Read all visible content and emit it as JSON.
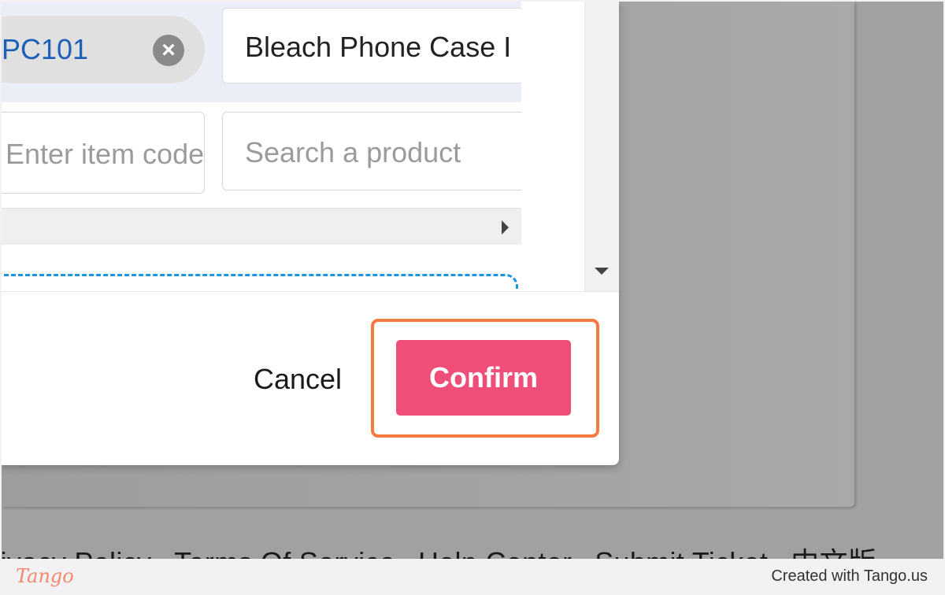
{
  "chip": {
    "label": "PC101",
    "close_icon": "close-circle-icon"
  },
  "row1": {
    "product_name": "Bleach Phone Case I"
  },
  "row2": {
    "code_placeholder": "Enter item code",
    "product_placeholder": "Search a product"
  },
  "scroll": {
    "right_arrow_icon": "triangle-right-icon",
    "down_arrow_icon": "triangle-down-icon"
  },
  "dialog": {
    "cancel_label": "Cancel",
    "confirm_label": "Confirm"
  },
  "footer": {
    "links": [
      "Privacy Policy",
      "Terms Of Service",
      "Help Center",
      "Submit Ticket",
      "中文版"
    ],
    "separator": "•"
  },
  "watermark": {
    "logo_text": "Tango",
    "created_with": "Created with Tango.us"
  },
  "colors": {
    "confirm": "#ee4e77",
    "highlight": "#f47b41",
    "chip_text": "#1f5fb6",
    "dashed": "#1a96e6"
  }
}
